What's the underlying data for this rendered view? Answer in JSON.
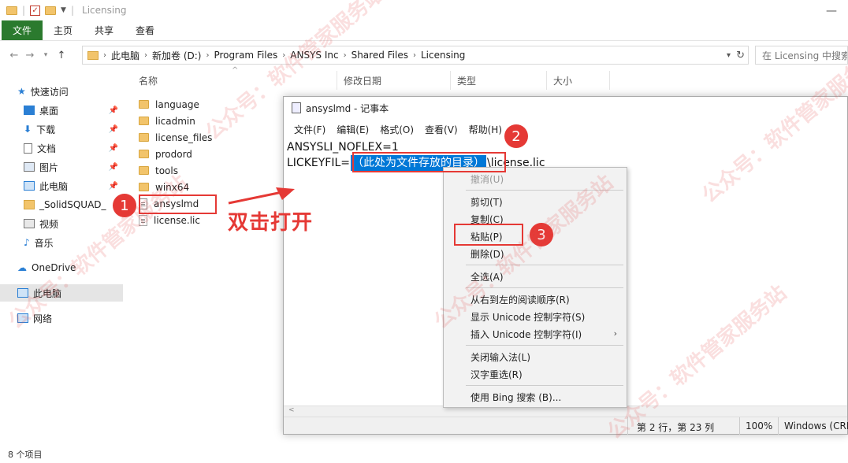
{
  "window": {
    "title": "Licensing"
  },
  "ribbon": {
    "tabs": [
      "文件",
      "主页",
      "共享",
      "查看"
    ]
  },
  "address": {
    "crumbs": [
      "此电脑",
      "新加卷 (D:)",
      "Program Files",
      "ANSYS Inc",
      "Shared Files",
      "Licensing"
    ],
    "search_placeholder": "在 Licensing 中搜索"
  },
  "nav": {
    "items": [
      {
        "label": "快速访问",
        "icon": "star-icon"
      },
      {
        "label": "桌面",
        "icon": "desktop-icon"
      },
      {
        "label": "下载",
        "icon": "download-icon"
      },
      {
        "label": "文档",
        "icon": "document-icon"
      },
      {
        "label": "图片",
        "icon": "picture-icon"
      },
      {
        "label": "此电脑",
        "icon": "computer-icon"
      },
      {
        "label": "_SolidSQUAD_",
        "icon": "folder-icon"
      },
      {
        "label": "视频",
        "icon": "video-icon"
      },
      {
        "label": "音乐",
        "icon": "music-icon"
      },
      {
        "label": "OneDrive",
        "icon": "cloud-icon"
      },
      {
        "label": "此电脑",
        "icon": "computer-icon"
      },
      {
        "label": "网络",
        "icon": "network-icon"
      }
    ]
  },
  "filelist": {
    "columns": [
      "名称",
      "修改日期",
      "类型",
      "大小"
    ],
    "files": [
      {
        "name": "language",
        "kind": "folder"
      },
      {
        "name": "licadmin",
        "kind": "folder"
      },
      {
        "name": "license_files",
        "kind": "folder"
      },
      {
        "name": "prodord",
        "kind": "folder"
      },
      {
        "name": "tools",
        "kind": "folder"
      },
      {
        "name": "winx64",
        "kind": "folder"
      },
      {
        "name": "ansyslmd",
        "kind": "doc"
      },
      {
        "name": "license.lic",
        "kind": "doc"
      }
    ],
    "status": "8 个项目"
  },
  "notepad": {
    "title": "ansyslmd - 记事本",
    "menu": [
      "文件(F)",
      "编辑(E)",
      "格式(O)",
      "查看(V)",
      "帮助(H)"
    ],
    "line1": "ANSYSLI_NOFLEX=1",
    "line2_prefix": "LICKEYFIL=",
    "line2_selected": "（此处为文件存放的目录）",
    "line2_suffix": "\\license.lic",
    "status": {
      "position": "第 2 行，第 23 列",
      "zoom": "100%",
      "encoding": "Windows (CRLF)"
    }
  },
  "context_menu": {
    "items": [
      {
        "label": "撤消(U)",
        "disabled": true
      },
      {
        "label": "剪切(T)",
        "disabled": false
      },
      {
        "label": "复制(C)",
        "disabled": false
      },
      {
        "label": "粘贴(P)",
        "disabled": false
      },
      {
        "label": "删除(D)",
        "disabled": false
      },
      {
        "label": "全选(A)",
        "disabled": false
      },
      {
        "label": "从右到左的阅读顺序(R)",
        "disabled": false
      },
      {
        "label": "显示 Unicode 控制字符(S)",
        "disabled": false
      },
      {
        "label": "插入 Unicode 控制字符(I)",
        "disabled": false
      },
      {
        "label": "关闭输入法(L)",
        "disabled": false
      },
      {
        "label": "汉字重选(R)",
        "disabled": false
      },
      {
        "label": "使用 Bing 搜索 (B)...",
        "disabled": false
      }
    ]
  },
  "annotations": {
    "badge1": "1",
    "badge2": "2",
    "badge3": "3",
    "instruction": "双击打开"
  },
  "watermark": {
    "text": "公众号：软件管家服务站"
  },
  "colors": {
    "accent_red": "#e53935",
    "selection_blue": "#0078d7",
    "file_tab_green": "#2b7a2e"
  }
}
